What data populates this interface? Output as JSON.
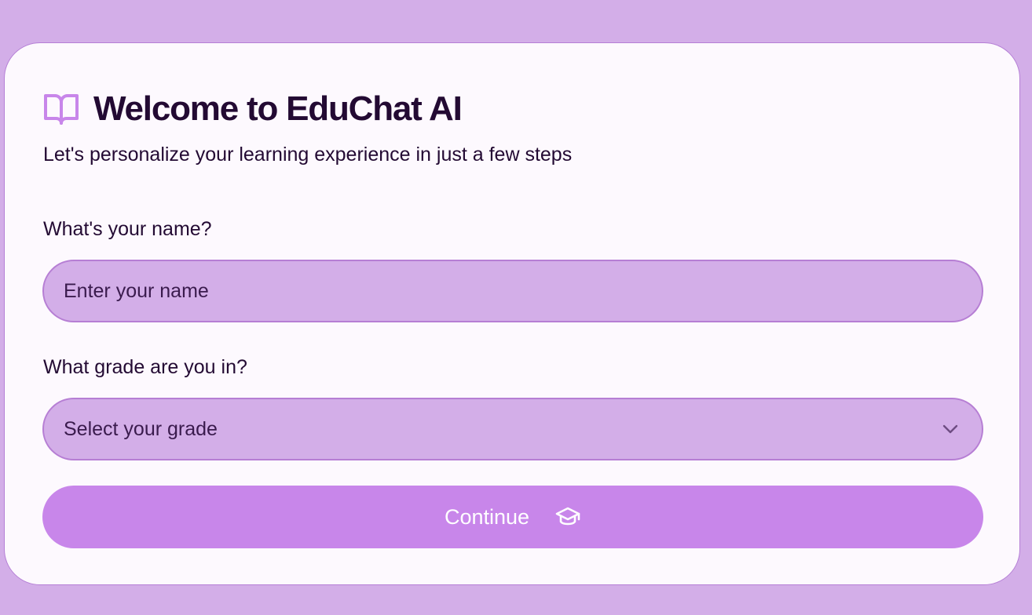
{
  "header": {
    "icon": "book-open-icon",
    "title": "Welcome to EduChat AI",
    "subtitle": "Let's personalize your learning experience in just a few steps"
  },
  "form": {
    "name_label": "What's your name?",
    "name_placeholder": "Enter your name",
    "name_value": "",
    "grade_label": "What grade are you in?",
    "grade_selected": "Select your grade",
    "grade_icon": "chevron-down-icon",
    "continue_label": "Continue",
    "continue_icon": "graduation-cap-icon"
  },
  "colors": {
    "background": "#d3aee8",
    "card": "#fdf9fe",
    "accent": "#c886ea",
    "text": "#230a33"
  }
}
